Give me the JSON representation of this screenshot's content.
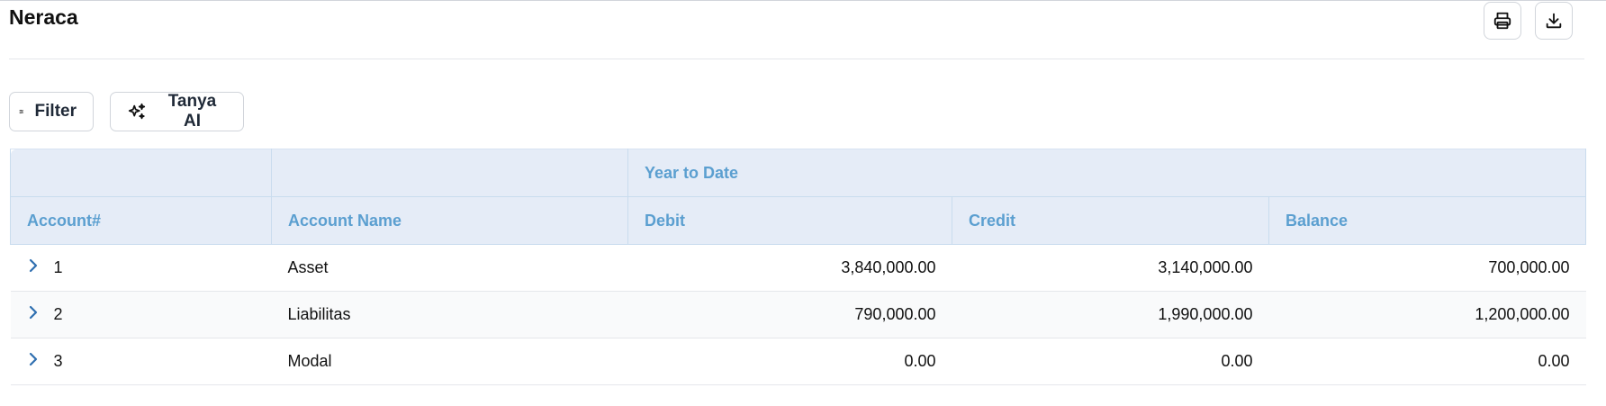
{
  "page": {
    "title": "Neraca"
  },
  "actions": {
    "print_icon": "printer-icon",
    "download_icon": "download-icon"
  },
  "toolbar": {
    "filter_label": "Filter",
    "filter_icon": "sliders-icon",
    "ai_label": "Tanya AI",
    "ai_icon": "sparkles-icon"
  },
  "table": {
    "group_header": "Year to Date",
    "columns": [
      "Account#",
      "Account Name",
      "Debit",
      "Credit",
      "Balance"
    ],
    "rows": [
      {
        "account": "1",
        "name": "Asset",
        "debit": "3,840,000.00",
        "credit": "3,140,000.00",
        "balance": "700,000.00"
      },
      {
        "account": "2",
        "name": "Liabilitas",
        "debit": "790,000.00",
        "credit": "1,990,000.00",
        "balance": "1,200,000.00"
      },
      {
        "account": "3",
        "name": "Modal",
        "debit": "0.00",
        "credit": "0.00",
        "balance": "0.00"
      }
    ]
  },
  "colors": {
    "header_bg": "#e5ecf7",
    "header_text": "#5b9fd0",
    "chevron": "#2f6fb0"
  }
}
